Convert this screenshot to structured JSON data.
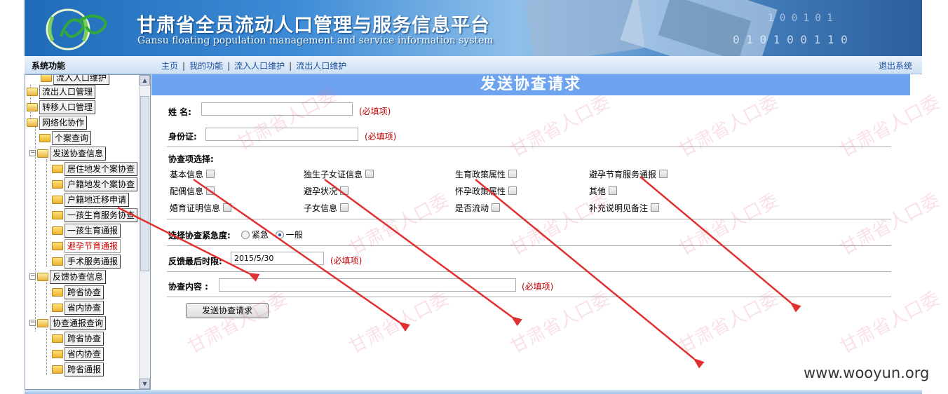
{
  "banner": {
    "title_cn": "甘肃省全员流动人口管理与服务信息平台",
    "title_en": "Gansu floating population management and service information system"
  },
  "nav": {
    "system_label": "系统功能",
    "links": [
      "主页",
      "我的功能",
      "流入人口维护",
      "流出人口维护"
    ],
    "logout": "退出系统"
  },
  "tree": {
    "items": [
      {
        "label": "流入人口维护",
        "level": 1,
        "state": "leaf"
      },
      {
        "label": "流出人口管理",
        "level": 0,
        "state": "closed"
      },
      {
        "label": "转移人口管理",
        "level": 0,
        "state": "closed"
      },
      {
        "label": "网络化协作",
        "level": 0,
        "state": "open"
      },
      {
        "label": "个案查询",
        "level": 1,
        "state": "leaf"
      },
      {
        "label": "发送协查信息",
        "level": 1,
        "state": "open"
      },
      {
        "label": "居住地发个案协查",
        "level": 2,
        "state": "leaf"
      },
      {
        "label": "户籍地发个案协查",
        "level": 2,
        "state": "leaf"
      },
      {
        "label": "户籍地迁移申请",
        "level": 2,
        "state": "leaf"
      },
      {
        "label": "一孩生育服务协查",
        "level": 2,
        "state": "leaf"
      },
      {
        "label": "一孩生育通报",
        "level": 2,
        "state": "leaf"
      },
      {
        "label": "避孕节育通报",
        "level": 2,
        "state": "leaf",
        "selected": true
      },
      {
        "label": "手术服务通报",
        "level": 2,
        "state": "leaf"
      },
      {
        "label": "反馈协查信息",
        "level": 1,
        "state": "open"
      },
      {
        "label": "跨省协查",
        "level": 2,
        "state": "leaf"
      },
      {
        "label": "省内协查",
        "level": 2,
        "state": "leaf"
      },
      {
        "label": "协查通报查询",
        "level": 1,
        "state": "open"
      },
      {
        "label": "跨省协查",
        "level": 2,
        "state": "leaf"
      },
      {
        "label": "省内协查",
        "level": 2,
        "state": "leaf"
      },
      {
        "label": "跨省通报",
        "level": 2,
        "state": "leaf"
      }
    ]
  },
  "form": {
    "heading": "发送协查请求",
    "name_label": "姓  名:",
    "name_value": "",
    "id_label": "身份证:",
    "id_value": "",
    "required_note": "(必填项)",
    "items_label": "协查项选择:",
    "checkboxes": [
      [
        "基本信息",
        "独生子女证信息",
        "生育政策属性",
        "避孕节育服务通报"
      ],
      [
        "配偶信息",
        "避孕状况",
        "怀孕政策属性",
        "其他"
      ],
      [
        "婚育证明信息",
        "子女信息",
        "是否流动",
        "补充说明见备注"
      ]
    ],
    "urgency_label": "选择协查紧急度:",
    "urgency_options": [
      "紧急",
      "一般"
    ],
    "urgency_selected": "一般",
    "deadline_label": "反馈最后时限:",
    "deadline_value": "2015/5/30",
    "content_label": "协查内容 :",
    "content_value": "",
    "submit_label": "发送协查请求"
  },
  "watermark": "甘肃省人口委",
  "site_mark": "www.wooyun.org",
  "colors": {
    "banner_blue": "#2b6fbd",
    "heading_bar": "#6ea3ef",
    "required_red": "#c00000",
    "arrow_red": "#e03030",
    "link_blue": "#1a4f9c"
  }
}
